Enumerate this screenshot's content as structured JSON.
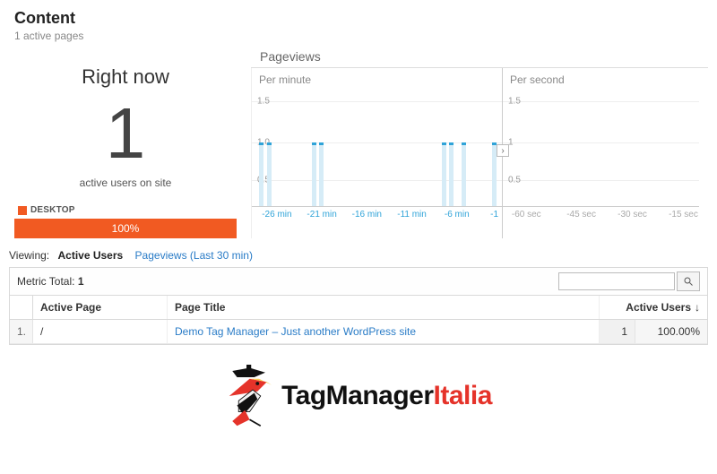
{
  "header": {
    "title": "Content",
    "subtitle": "1 active pages"
  },
  "realtime": {
    "right_now_label": "Right now",
    "count": "1",
    "subtitle": "active users on site",
    "device_label": "DESKTOP",
    "device_pct": "100%"
  },
  "pageviews": {
    "title": "Pageviews",
    "per_minute": {
      "title": "Per minute",
      "yticks": [
        "1.5",
        "1.0",
        "0.5"
      ],
      "xticks": [
        "-26 min",
        "-21 min",
        "-16 min",
        "-11 min",
        "-6 min",
        "-1"
      ]
    },
    "per_second": {
      "title": "Per second",
      "yticks": [
        "1.5",
        "1",
        "0.5"
      ],
      "xticks": [
        "-60 sec",
        "-45 sec",
        "-30 sec",
        "-15 sec"
      ]
    }
  },
  "tabs": {
    "label": "Viewing:",
    "active": "Active Users",
    "secondary": "Pageviews (Last 30 min)"
  },
  "panel": {
    "metric_label": "Metric Total:",
    "metric_value": "1",
    "columns": {
      "active_page": "Active Page",
      "page_title": "Page Title",
      "active_users": "Active Users"
    },
    "row": {
      "index": "1.",
      "active_page": "/",
      "page_title": "Demo Tag Manager – Just another WordPress site",
      "active_users_value": "1",
      "active_users_pct": "100.00%"
    }
  },
  "logo": {
    "brand1": "TagManager",
    "brand2": "Italia"
  },
  "chart_data": [
    {
      "type": "bar",
      "title": "Per minute",
      "xlabel": "minute",
      "ylabel": "pageviews",
      "ylim": [
        0,
        2
      ],
      "x": [
        -27,
        -26,
        -21,
        -20,
        -6,
        -5,
        -4,
        -1
      ],
      "values": [
        1,
        1,
        1,
        1,
        1,
        1,
        1,
        1
      ]
    },
    {
      "type": "bar",
      "title": "Per second",
      "xlabel": "second",
      "ylabel": "pageviews",
      "ylim": [
        0,
        2
      ],
      "x": [],
      "values": []
    }
  ]
}
